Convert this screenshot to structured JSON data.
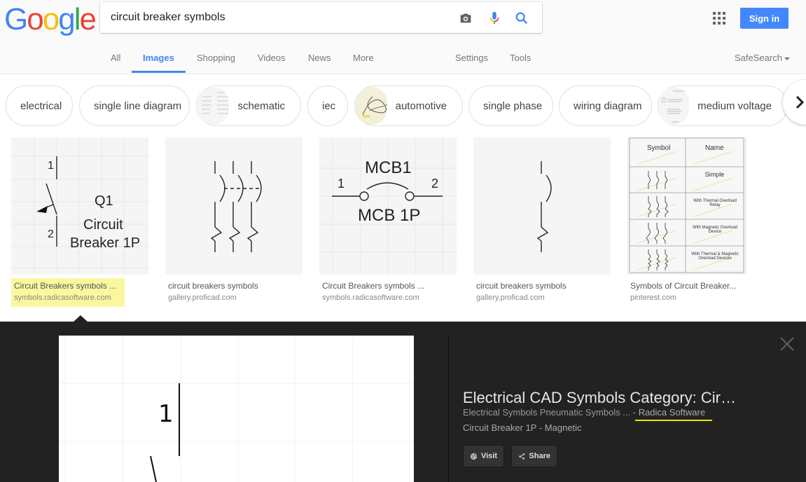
{
  "logo": {
    "letters": [
      "G",
      "o",
      "o",
      "g",
      "l",
      "e"
    ],
    "colors": [
      "#4285f4",
      "#ea4335",
      "#fbbc05",
      "#4285f4",
      "#34a853",
      "#ea4335"
    ]
  },
  "search": {
    "query": "circuit breaker symbols"
  },
  "header": {
    "sign_in": "Sign in",
    "safesearch": "SafeSearch"
  },
  "tabs": {
    "all": "All",
    "images": "Images",
    "shopping": "Shopping",
    "videos": "Videos",
    "news": "News",
    "more": "More",
    "settings": "Settings",
    "tools": "Tools",
    "active": "Images"
  },
  "chips": [
    {
      "label": "electrical"
    },
    {
      "label": "single line diagram"
    },
    {
      "label": "schematic"
    },
    {
      "label": "iec"
    },
    {
      "label": "automotive"
    },
    {
      "label": "single phase"
    },
    {
      "label": "wiring diagram"
    },
    {
      "label": "medium voltage"
    }
  ],
  "results": [
    {
      "title": "Circuit Breakers symbols ...",
      "site": "symbols.radicasoftware.com",
      "image_text": {
        "top": "1",
        "bottom": "2",
        "q": "Q1",
        "line1": "Circuit",
        "line2": "Breaker 1P"
      }
    },
    {
      "title": "circuit breakers symbols",
      "site": "gallery.proficad.com"
    },
    {
      "title": "Circuit Breakers symbols ...",
      "site": "symbols.radicasoftware.com",
      "image_text": {
        "title": "MCB1",
        "left": "1",
        "right": "2",
        "sub": "MCB 1P"
      }
    },
    {
      "title": "circuit breakers symbols",
      "site": "gallery.proficad.com"
    },
    {
      "title": "Symbols of Circuit Breaker...",
      "site": "pinterest.com",
      "image_text": {
        "col1": "Symbol",
        "col2": "Name",
        "rows": [
          "Simple",
          "With Thermal Overload Relay",
          "With Magnetic Overload Device",
          "With Thermal & Magnetic Overload Devices"
        ]
      }
    }
  ],
  "preview": {
    "title": "Electrical CAD Symbols Category: Circuit Breakers",
    "subtitle": "Electrical Symbols Pneumatic Symbols ... ",
    "source": "- Radica Software",
    "description": "Circuit Breaker 1P - Magnetic",
    "visit": "Visit",
    "share": "Share",
    "image_label": "1",
    "highlight_color": "#f0e300"
  }
}
